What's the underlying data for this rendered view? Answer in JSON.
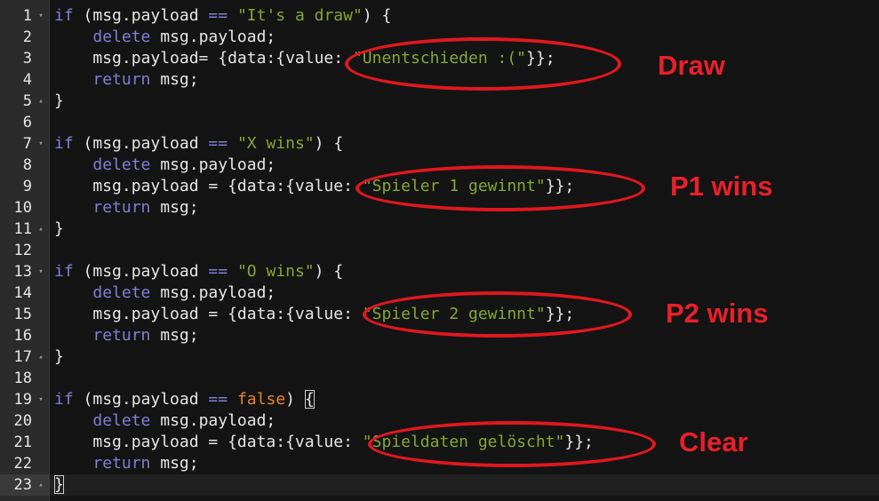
{
  "editor": {
    "lines": [
      {
        "num": "1",
        "fold": "▾",
        "tokens": [
          {
            "t": "kw",
            "v": "if"
          },
          {
            "t": "plain",
            "v": " (msg.payload "
          },
          {
            "t": "kw",
            "v": "=="
          },
          {
            "t": "plain",
            "v": " "
          },
          {
            "t": "str",
            "v": "\"It's a draw\""
          },
          {
            "t": "plain",
            "v": ") {"
          }
        ]
      },
      {
        "num": "2",
        "fold": "",
        "tokens": [
          {
            "t": "plain",
            "v": "    "
          },
          {
            "t": "kw",
            "v": "delete"
          },
          {
            "t": "plain",
            "v": " msg.payload;"
          }
        ]
      },
      {
        "num": "3",
        "fold": "",
        "tokens": [
          {
            "t": "plain",
            "v": "    msg.payload= {data:{value: "
          },
          {
            "t": "str",
            "v": "\"Unentschieden :(\""
          },
          {
            "t": "plain",
            "v": "}};"
          }
        ]
      },
      {
        "num": "4",
        "fold": "",
        "tokens": [
          {
            "t": "plain",
            "v": "    "
          },
          {
            "t": "kw",
            "v": "return"
          },
          {
            "t": "plain",
            "v": " msg;"
          }
        ]
      },
      {
        "num": "5",
        "fold": "▴",
        "tokens": [
          {
            "t": "plain",
            "v": "}"
          }
        ]
      },
      {
        "num": "6",
        "fold": "",
        "tokens": []
      },
      {
        "num": "7",
        "fold": "▾",
        "tokens": [
          {
            "t": "kw",
            "v": "if"
          },
          {
            "t": "plain",
            "v": " (msg.payload "
          },
          {
            "t": "kw",
            "v": "=="
          },
          {
            "t": "plain",
            "v": " "
          },
          {
            "t": "str",
            "v": "\"X wins\""
          },
          {
            "t": "plain",
            "v": ") {"
          }
        ]
      },
      {
        "num": "8",
        "fold": "",
        "tokens": [
          {
            "t": "plain",
            "v": "    "
          },
          {
            "t": "kw",
            "v": "delete"
          },
          {
            "t": "plain",
            "v": " msg.payload;"
          }
        ]
      },
      {
        "num": "9",
        "fold": "",
        "tokens": [
          {
            "t": "plain",
            "v": "    msg.payload = {data:{value: "
          },
          {
            "t": "str",
            "v": "\"Spieler 1 gewinnt\""
          },
          {
            "t": "plain",
            "v": "}};"
          }
        ]
      },
      {
        "num": "10",
        "fold": "",
        "tokens": [
          {
            "t": "plain",
            "v": "    "
          },
          {
            "t": "kw",
            "v": "return"
          },
          {
            "t": "plain",
            "v": " msg;"
          }
        ]
      },
      {
        "num": "11",
        "fold": "▴",
        "tokens": [
          {
            "t": "plain",
            "v": "}"
          }
        ]
      },
      {
        "num": "12",
        "fold": "",
        "tokens": []
      },
      {
        "num": "13",
        "fold": "▾",
        "tokens": [
          {
            "t": "kw",
            "v": "if"
          },
          {
            "t": "plain",
            "v": " (msg.payload "
          },
          {
            "t": "kw",
            "v": "=="
          },
          {
            "t": "plain",
            "v": " "
          },
          {
            "t": "str",
            "v": "\"O wins\""
          },
          {
            "t": "plain",
            "v": ") {"
          }
        ]
      },
      {
        "num": "14",
        "fold": "",
        "tokens": [
          {
            "t": "plain",
            "v": "    "
          },
          {
            "t": "kw",
            "v": "delete"
          },
          {
            "t": "plain",
            "v": " msg.payload;"
          }
        ]
      },
      {
        "num": "15",
        "fold": "",
        "tokens": [
          {
            "t": "plain",
            "v": "    msg.payload = {data:{value: "
          },
          {
            "t": "str",
            "v": "\"Spieler 2 gewinnt\""
          },
          {
            "t": "plain",
            "v": "}};"
          }
        ]
      },
      {
        "num": "16",
        "fold": "",
        "tokens": [
          {
            "t": "plain",
            "v": "    "
          },
          {
            "t": "kw",
            "v": "return"
          },
          {
            "t": "plain",
            "v": " msg;"
          }
        ]
      },
      {
        "num": "17",
        "fold": "▴",
        "tokens": [
          {
            "t": "plain",
            "v": "}"
          }
        ]
      },
      {
        "num": "18",
        "fold": "",
        "tokens": []
      },
      {
        "num": "19",
        "fold": "▾",
        "tokens": [
          {
            "t": "kw",
            "v": "if"
          },
          {
            "t": "plain",
            "v": " (msg.payload "
          },
          {
            "t": "kw",
            "v": "=="
          },
          {
            "t": "plain",
            "v": " "
          },
          {
            "t": "bool",
            "v": "false"
          },
          {
            "t": "plain",
            "v": ") "
          },
          {
            "t": "bracket",
            "v": "{"
          }
        ]
      },
      {
        "num": "20",
        "fold": "",
        "tokens": [
          {
            "t": "plain",
            "v": "    "
          },
          {
            "t": "kw",
            "v": "delete"
          },
          {
            "t": "plain",
            "v": " msg.payload;"
          }
        ]
      },
      {
        "num": "21",
        "fold": "",
        "tokens": [
          {
            "t": "plain",
            "v": "    msg.payload = {data:{value: "
          },
          {
            "t": "str",
            "v": "\"Spieldaten gelöscht\""
          },
          {
            "t": "plain",
            "v": "}};"
          }
        ]
      },
      {
        "num": "22",
        "fold": "",
        "tokens": [
          {
            "t": "plain",
            "v": "    "
          },
          {
            "t": "kw",
            "v": "return"
          },
          {
            "t": "plain",
            "v": " msg;"
          }
        ]
      },
      {
        "num": "23",
        "fold": "▴",
        "active": true,
        "tokens": [
          {
            "t": "bracket",
            "v": "}"
          }
        ]
      }
    ]
  },
  "annotations": [
    {
      "label": "Draw"
    },
    {
      "label": "P1 wins"
    },
    {
      "label": "P2 wins"
    },
    {
      "label": "Clear"
    }
  ],
  "colors": {
    "background": "#141414",
    "gutter": "#2b2b2b",
    "keyword": "#7f7fd6",
    "string": "#86a636",
    "boolean": "#e8832f",
    "annotation": "#e8202a"
  }
}
